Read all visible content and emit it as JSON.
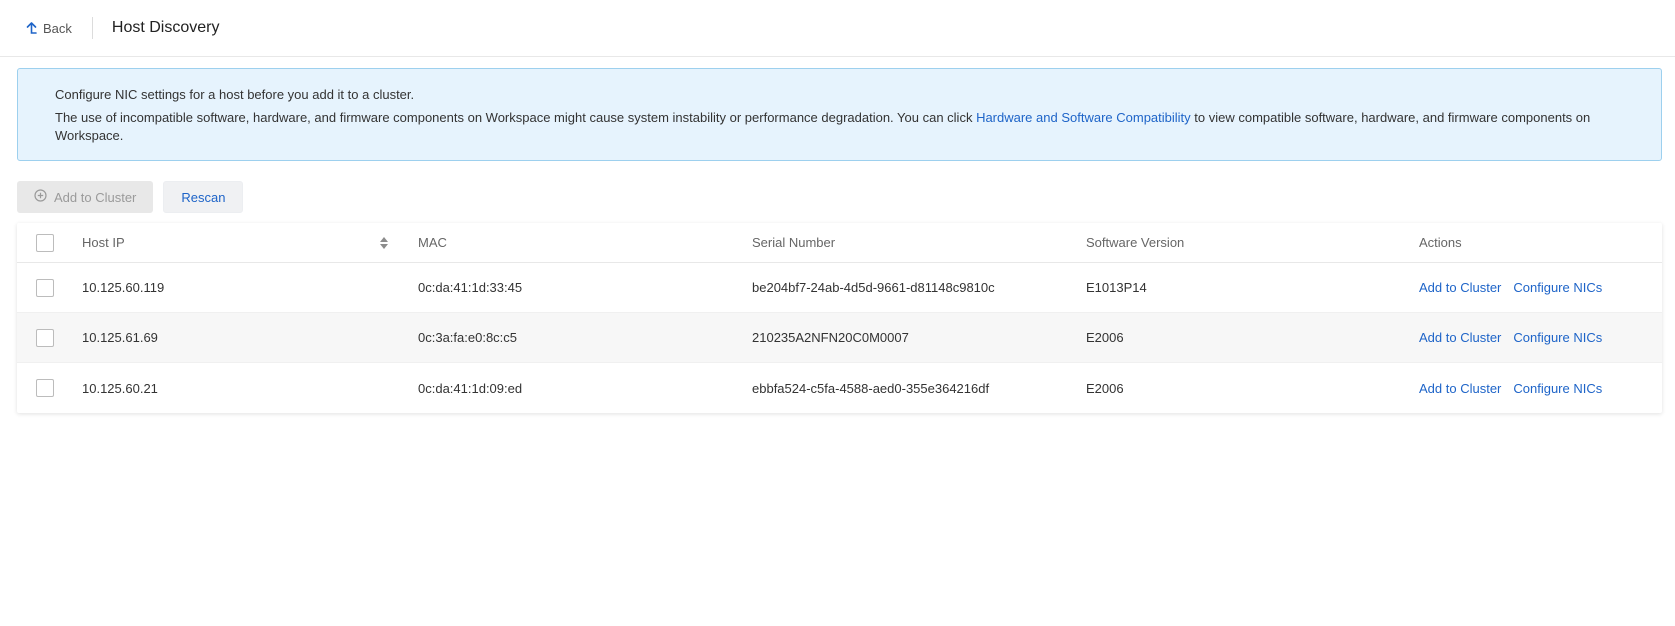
{
  "header": {
    "back_label": "Back",
    "title": "Host Discovery"
  },
  "notice": {
    "line1": "Configure NIC settings for a host before you add it to a cluster.",
    "line2_before": "The use of incompatible software, hardware, and firmware components on Workspace might cause system instability or performance degradation. You can click ",
    "line2_link": "Hardware and Software Compatibility",
    "line2_after": " to view compatible software, hardware, and firmware components on Workspace."
  },
  "toolbar": {
    "add_label": "Add to Cluster",
    "rescan_label": "Rescan"
  },
  "table": {
    "columns": {
      "host_ip": "Host IP",
      "mac": "MAC",
      "serial": "Serial Number",
      "software": "Software Version",
      "actions": "Actions"
    },
    "action_labels": {
      "add": "Add to Cluster",
      "configure": "Configure NICs"
    },
    "rows": [
      {
        "host_ip": "10.125.60.119",
        "mac": "0c:da:41:1d:33:45",
        "serial": "be204bf7-24ab-4d5d-9661-d81148c9810c",
        "software": "E1013P14"
      },
      {
        "host_ip": "10.125.61.69",
        "mac": "0c:3a:fa:e0:8c:c5",
        "serial": "210235A2NFN20C0M0007",
        "software": "E2006"
      },
      {
        "host_ip": "10.125.60.21",
        "mac": "0c:da:41:1d:09:ed",
        "serial": "ebbfa524-c5fa-4588-aed0-355e364216df",
        "software": "E2006"
      }
    ]
  },
  "colors": {
    "link": "#1e64c8",
    "notice_bg": "#e6f3fd",
    "notice_border": "#9dd0ee"
  }
}
